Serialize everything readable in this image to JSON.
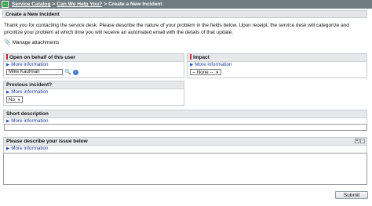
{
  "breadcrumb": {
    "items": [
      "Service Catalog",
      "Can We Help You?"
    ],
    "separator": ">",
    "current": "Create a New Incident"
  },
  "form": {
    "title": "Create a New Incident",
    "intro": "Thank you for contacting the service desk. Please describe the nature of your problem in the fields below. Upon receipt, the service desk will categorize and prioritize your problem at which time you will receive an automated email with the details of that update.",
    "attachments_label": "Manage attachments",
    "more_info_label": "More information",
    "on_behalf": {
      "label": "Open on behalf of this user",
      "value": "Mike Kaufman"
    },
    "impact": {
      "label": "Impact",
      "value": "-- None --"
    },
    "previous": {
      "label": "Previous incident?",
      "value": "No"
    },
    "short_description": {
      "label": "Short description",
      "value": ""
    },
    "issue": {
      "label": "Please describe your issue below",
      "value": ""
    },
    "submit_label": "Submit"
  },
  "colors": {
    "topbar": "#6f7c82",
    "required": "#d0262b",
    "link": "#1a3c9a"
  },
  "icons": [
    "back-icon",
    "paperclip-icon",
    "triangle-icon",
    "search-icon",
    "info-icon",
    "expand-icon",
    "collapse-icon"
  ]
}
